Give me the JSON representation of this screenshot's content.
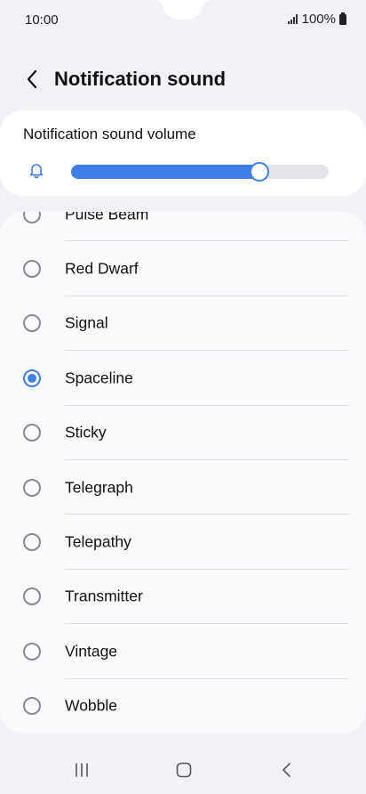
{
  "status_bar": {
    "time": "10:00",
    "battery": "100%"
  },
  "header": {
    "title": "Notification sound"
  },
  "volume": {
    "label": "Notification sound volume",
    "level": 0.73,
    "accent_color": "#3d7ee9"
  },
  "sounds": {
    "items": [
      {
        "label": "Pulse Beam",
        "selected": false
      },
      {
        "label": "Red Dwarf",
        "selected": false
      },
      {
        "label": "Signal",
        "selected": false
      },
      {
        "label": "Spaceline",
        "selected": true
      },
      {
        "label": "Sticky",
        "selected": false
      },
      {
        "label": "Telegraph",
        "selected": false
      },
      {
        "label": "Telepathy",
        "selected": false
      },
      {
        "label": "Transmitter",
        "selected": false
      },
      {
        "label": "Vintage",
        "selected": false
      },
      {
        "label": "Wobble",
        "selected": false
      }
    ]
  },
  "nav": {
    "icons": [
      "recent-apps-icon",
      "home-icon",
      "back-icon"
    ]
  }
}
